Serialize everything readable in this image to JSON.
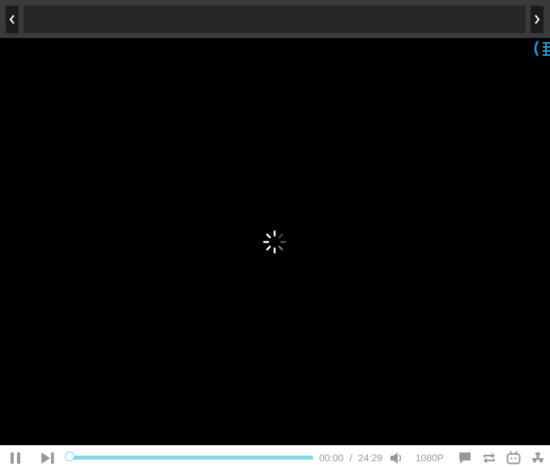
{
  "player": {
    "current_time": "00:00",
    "time_separator": "/",
    "duration": "24:29",
    "quality": "1080P",
    "progress_fraction": 0.0,
    "accent_color": "#7fd8ea",
    "state": "loading"
  },
  "icons": {
    "prev": "chevron-left-icon",
    "next": "chevron-right-icon",
    "pause": "pause-icon",
    "skip_next": "skip-next-icon",
    "volume": "volume-icon",
    "danmaku": "comment-icon",
    "loop": "loop-icon",
    "bilibili": "tv-mascot-icon",
    "more": "radiation-icon",
    "spinner": "loading-spinner-icon"
  }
}
